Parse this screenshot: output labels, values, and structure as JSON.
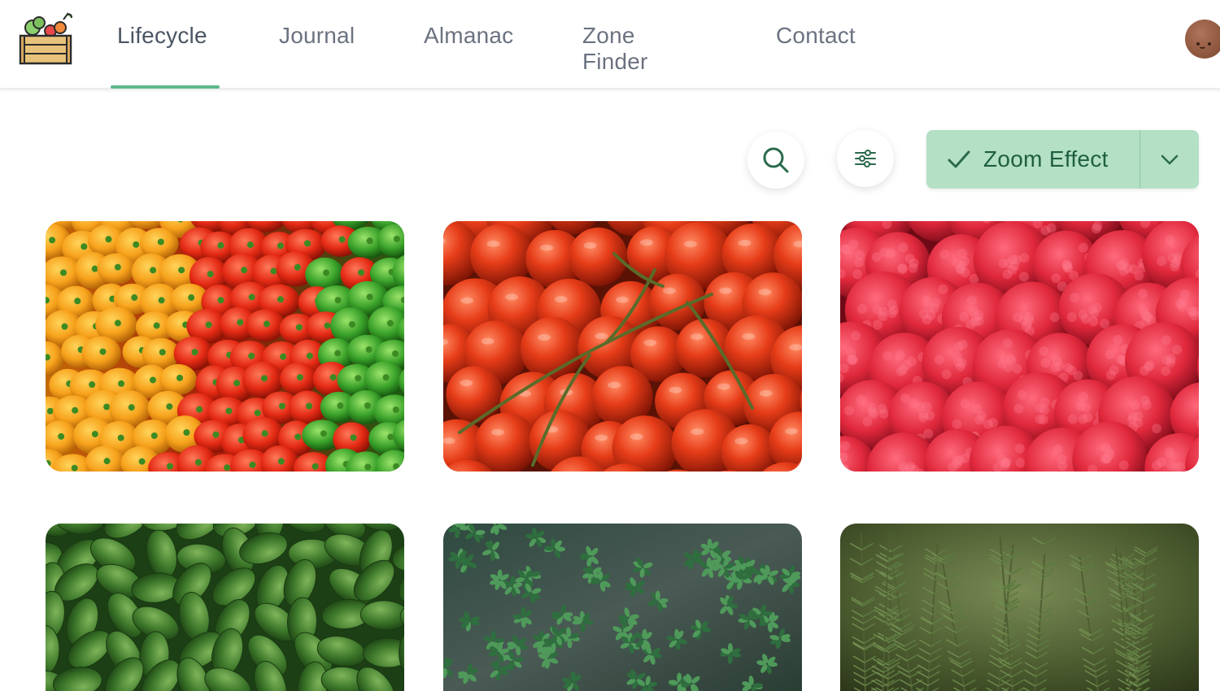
{
  "header": {
    "logo_icon": "vegetable-crate-icon",
    "nav": [
      {
        "label": "Lifecycle",
        "active": true
      },
      {
        "label": "Journal",
        "active": false
      },
      {
        "label": "Almanac",
        "active": false
      },
      {
        "label": "Zone Finder",
        "active": false
      },
      {
        "label": "Contact",
        "active": false
      }
    ],
    "avatar_icon": "user-avatar-icon"
  },
  "toolbar": {
    "search_icon": "search-icon",
    "filter_icon": "sliders-icon",
    "zoom_effect_label": "Zoom Effect",
    "zoom_effect_checked": true,
    "zoom_effect_menu_icon": "chevron-down-icon"
  },
  "gallery": {
    "images": [
      {
        "subject": "bell-peppers"
      },
      {
        "subject": "vine-tomatoes"
      },
      {
        "subject": "raspberries"
      },
      {
        "subject": "basil"
      },
      {
        "subject": "thyme"
      },
      {
        "subject": "rosemary"
      }
    ]
  },
  "colors": {
    "accent": "#5cb98a",
    "button_bg": "#b4e0c5",
    "button_text": "#1f5f40",
    "nav_text": "#6b7280"
  }
}
